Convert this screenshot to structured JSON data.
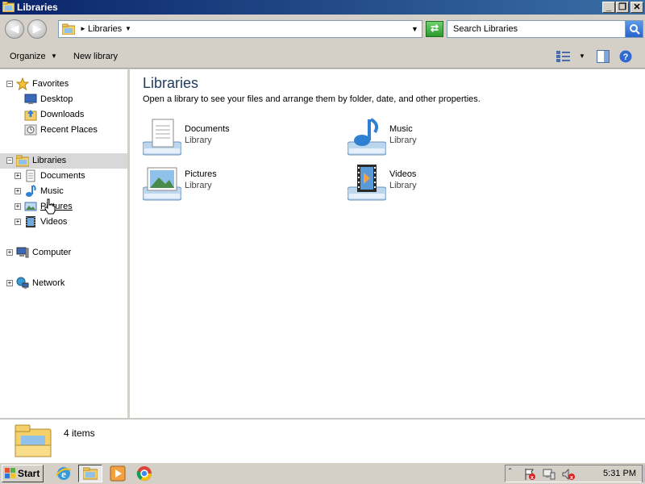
{
  "window": {
    "title": "Libraries",
    "controls": [
      "_",
      "❐",
      "✕"
    ]
  },
  "address": {
    "breadcrumb": "Libraries",
    "search_placeholder": "Search Libraries"
  },
  "toolbar": {
    "organize": "Organize",
    "new_library": "New library"
  },
  "nav": {
    "favorites": "Favorites",
    "fav_items": [
      "Desktop",
      "Downloads",
      "Recent Places"
    ],
    "libraries": "Libraries",
    "lib_items": [
      "Documents",
      "Music",
      "Pictures",
      "Videos"
    ],
    "computer": "Computer",
    "network": "Network"
  },
  "content": {
    "title": "Libraries",
    "subtitle": "Open a library to see your files and arrange them by folder, date, and other properties.",
    "libraries": [
      {
        "name": "Documents",
        "type": "Library"
      },
      {
        "name": "Music",
        "type": "Library"
      },
      {
        "name": "Pictures",
        "type": "Library"
      },
      {
        "name": "Videos",
        "type": "Library"
      }
    ]
  },
  "details": {
    "count": "4 items"
  },
  "taskbar": {
    "start": "Start",
    "clock": "5:31 PM"
  }
}
